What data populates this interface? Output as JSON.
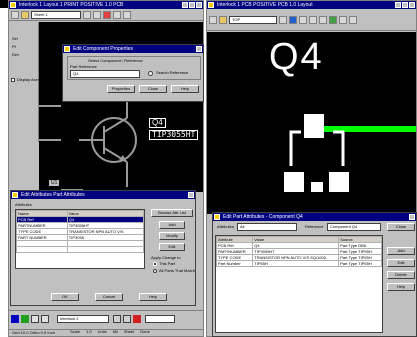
{
  "left_window": {
    "title": "Interlock 1 Layout 1 PRINT POSITIVE 1.0 PCB",
    "font_combo": "Sheet 1",
    "side_labels": [
      "Sel",
      "Pt",
      "Dev"
    ],
    "checkbox_label": "Display Axes",
    "design_labels": [
      "Q4",
      "TIP3055HT"
    ],
    "pin_label": "U1",
    "status_text": "Grid  10.0  Ortho  0.5  Inch"
  },
  "component_dialog": {
    "title": "Edit Component Properties",
    "fields": [
      "Component",
      "Interplace"
    ],
    "group_label": "Select Component / Reference",
    "input_label": "Part Reference",
    "input_value": "Q4",
    "radio_label": "Search Reference",
    "buttons": [
      "Properties",
      "Close",
      "Help"
    ]
  },
  "attr_dialog": {
    "title": "Edit Attributes Part Attributes",
    "section_label": "Attributes",
    "columns": [
      "Name",
      "Value"
    ],
    "rows": [
      [
        "PCB Ref",
        "Q4"
      ],
      [
        "PARTNUMBER",
        "TIP3055HT"
      ],
      [
        "TYPE CODE",
        "TRANSISTOR NPN AUTO V/S"
      ],
      [
        "PART NUMBER",
        "TIP3055"
      ]
    ],
    "side_buttons": [
      "Browse Attr List",
      "Add",
      "Modify",
      "Edit"
    ],
    "option_label": "Apply Change to",
    "options": [
      "This Part",
      "All Parts That Match"
    ],
    "footer_buttons": [
      "OK",
      "Cancel",
      "Help"
    ]
  },
  "right_window": {
    "title": "Interlock 1 PCB POSITIVE PCB 1.0 Layout",
    "layer_combo": "TOP",
    "silk_label": "Q4"
  },
  "bottom_dialog": {
    "title": "Edit Part Attributes  -  Component Q4",
    "combo_label": "Attributes",
    "combo_value": "All",
    "source_label": "Reference",
    "source_value": "Component Q4",
    "columns": [
      "Attribute",
      "Value",
      "Source"
    ],
    "rows": [
      [
        "PCB Ref",
        "Q4",
        "Part Type DB5",
        ""
      ],
      [
        "PARTNUMBER",
        "TIP3055HT",
        "Part Type TIP55H"
      ],
      [
        "TYPE CODE",
        "TRANSISTOR NPN AUTO V/S  SQ/1000",
        "Part Type TIP55H"
      ],
      [
        "Part Number",
        "TIP55H",
        "Part Type TIP55H"
      ]
    ],
    "side_buttons": [
      "Close",
      "Add",
      "Edit",
      "Delete",
      "Help"
    ]
  },
  "taskbar": {
    "combo_value": "Interlock 2",
    "readout_labels": [
      "Scale",
      "1.0",
      "Units",
      "Mil",
      "Sheet",
      "Done"
    ]
  },
  "colors": {
    "title_blue": "#000080",
    "canvas_black": "#000000",
    "silk_white": "#ffffff",
    "trace_green": "#00ff00",
    "outline_cyan": "#00c0c0",
    "chrome_gray": "#c0c0c0"
  }
}
